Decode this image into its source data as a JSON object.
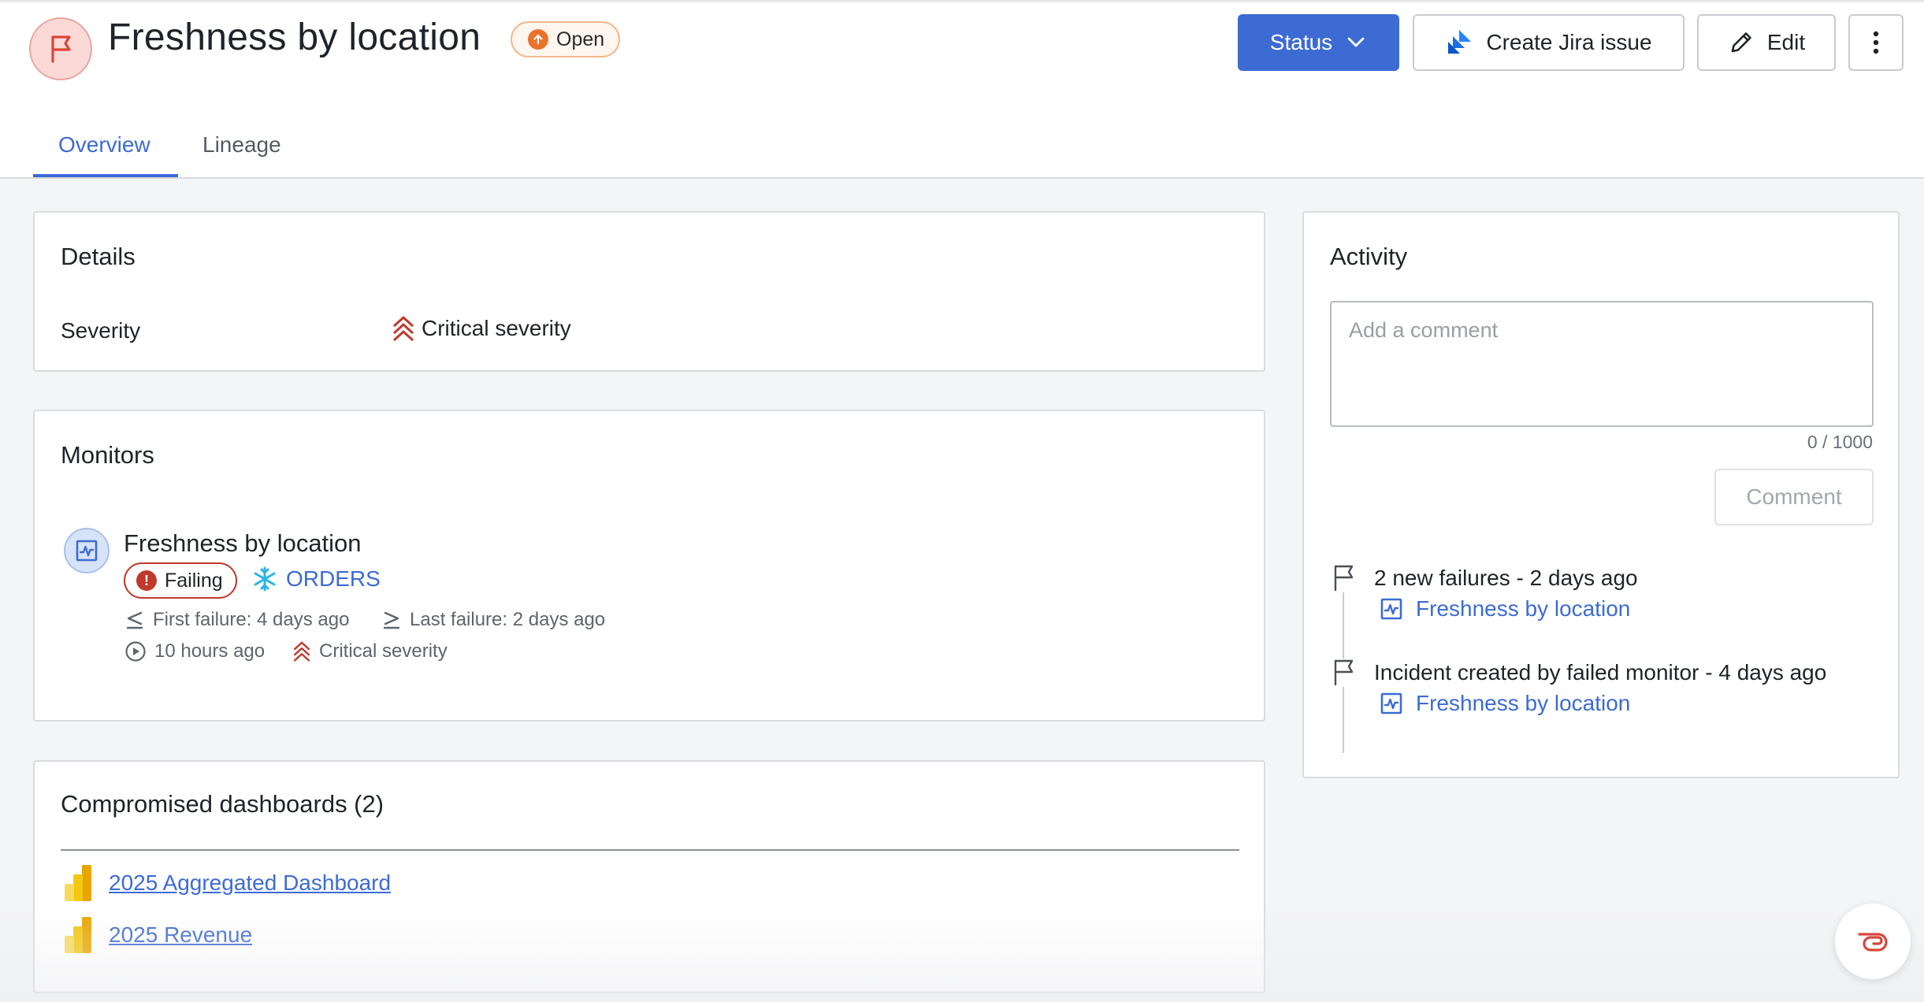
{
  "header": {
    "title": "Freshness by location",
    "status_badge": "Open",
    "buttons": {
      "status": "Status",
      "jira": "Create Jira issue",
      "edit": "Edit"
    }
  },
  "tabs": [
    {
      "label": "Overview",
      "active": true
    },
    {
      "label": "Lineage",
      "active": false
    }
  ],
  "details": {
    "title": "Details",
    "severity_label": "Severity",
    "severity_value": "Critical severity"
  },
  "monitors": {
    "title": "Monitors",
    "items": [
      {
        "name": "Freshness by location",
        "status": "Failing",
        "table": "ORDERS",
        "first_failure": "First failure: 4 days ago",
        "last_failure": "Last failure: 2 days ago",
        "last_run": "10 hours ago",
        "severity": "Critical severity"
      }
    ]
  },
  "dashboards": {
    "title": "Compromised dashboards (2)",
    "items": [
      {
        "label": "2025 Aggregated Dashboard"
      },
      {
        "label": "2025 Revenue"
      }
    ]
  },
  "activity": {
    "title": "Activity",
    "comment_placeholder": "Add a comment",
    "counter": "0 / 1000",
    "comment_button": "Comment",
    "events": [
      {
        "text": "2 new failures - 2 days ago",
        "link": "Freshness by location"
      },
      {
        "text": "Incident created by failed monitor - 4 days ago",
        "link": "Freshness by location"
      }
    ]
  },
  "colors": {
    "accent": "#3d6bd4",
    "critical": "#c0392b",
    "open": "#e8732c"
  }
}
